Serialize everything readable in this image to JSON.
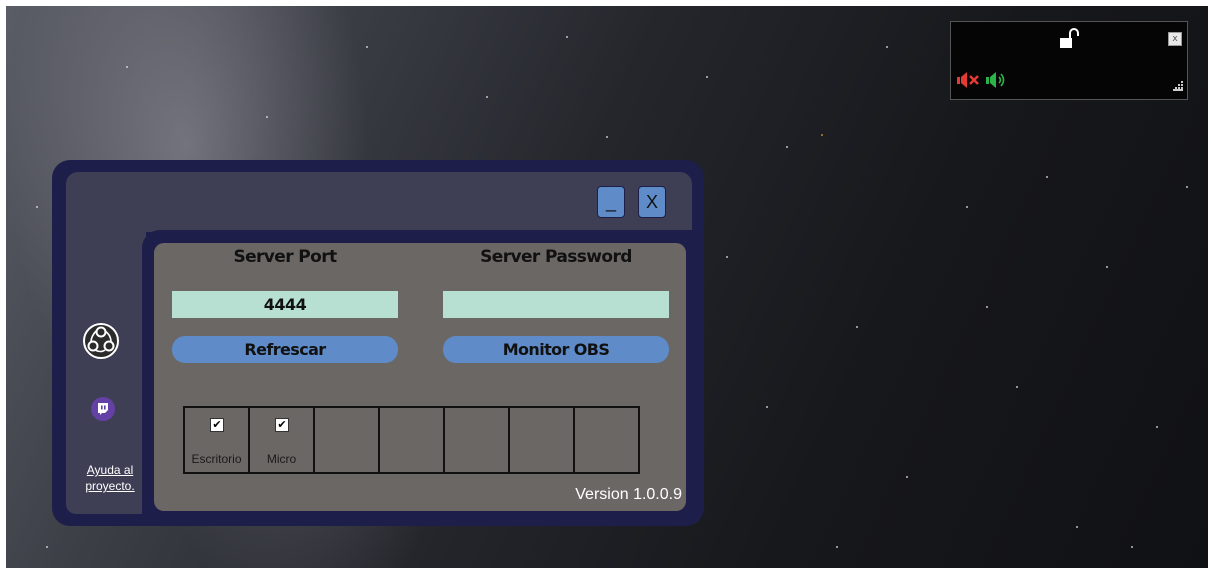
{
  "overlay": {
    "close_label": "x",
    "icons": [
      "unlocked-padlock-icon",
      "speaker-muted-icon",
      "speaker-volume-icon",
      "resize-grip-icon"
    ],
    "colors": {
      "muted": "#e53935",
      "volume": "#2eb34a"
    }
  },
  "window": {
    "minimize_label": "_",
    "close_label": "X"
  },
  "sidebar": {
    "icons": [
      "obs-logo-icon",
      "twitch-logo-icon"
    ],
    "help_line1": "Ayuda al",
    "help_line2": "proyecto."
  },
  "server": {
    "port_header": "Server Port",
    "password_header": "Server Password",
    "port_value": "4444",
    "password_value": "",
    "refresh_label": "Refrescar",
    "monitor_label": "Monitor OBS"
  },
  "audio_sources": [
    {
      "label": "Escritorio",
      "checked": true,
      "check_glyph": "✔"
    },
    {
      "label": "Micro",
      "checked": true,
      "check_glyph": "✔"
    },
    {
      "label": "",
      "checked": false,
      "check_glyph": ""
    },
    {
      "label": "",
      "checked": false,
      "check_glyph": ""
    },
    {
      "label": "",
      "checked": false,
      "check_glyph": ""
    },
    {
      "label": "",
      "checked": false,
      "check_glyph": ""
    },
    {
      "label": "",
      "checked": false,
      "check_glyph": ""
    }
  ],
  "version_text": "Version 1.0.0.9",
  "colors": {
    "frame": "#1e1e4a",
    "panel": "#6b6765",
    "input_bg": "#b8e0d2",
    "button_bg": "#5f8cc8",
    "twitch": "#6441a5"
  }
}
